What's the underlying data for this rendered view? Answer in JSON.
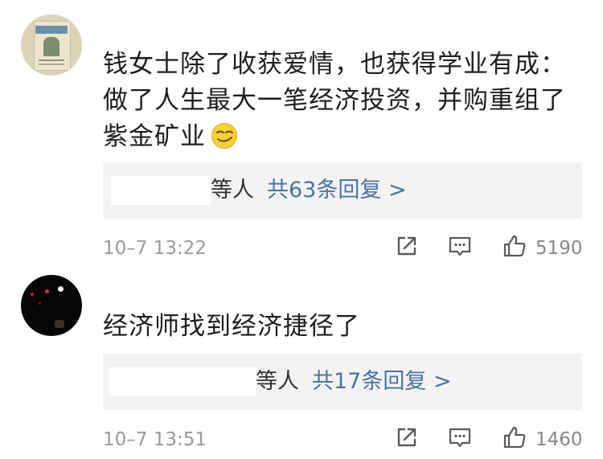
{
  "comments": [
    {
      "text": "钱女士除了收获爱情，也获得学业有成：做了人生最大一笔经济投资，并购重组了紫金矿业",
      "emoji": "smirk-emoji",
      "reply_people": "等人",
      "reply_link": "共63条回复 >",
      "reply_count": 63,
      "timestamp": "10–7 13:22",
      "likes": "5190"
    },
    {
      "text": "经济师找到经济捷径了",
      "reply_people": "等人",
      "reply_link": "共17条回复 >",
      "reply_count": 17,
      "timestamp": "10–7 13:51",
      "likes": "1460"
    }
  ],
  "icons": {
    "share": "share-icon",
    "comment": "comment-icon",
    "like": "thumbs-up-icon"
  },
  "colors": {
    "link": "#4b73a6",
    "meta": "#9a9a9a",
    "reply_bg": "#f3f3f3"
  }
}
